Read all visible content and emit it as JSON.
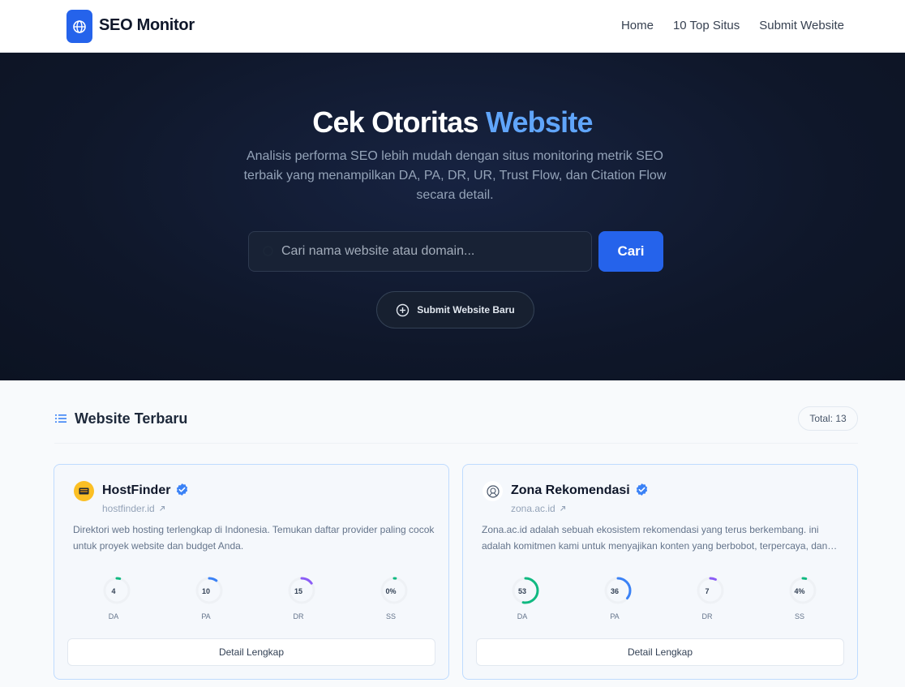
{
  "header": {
    "brand": "SEO Monitor",
    "nav": [
      "Home",
      "10 Top Situs",
      "Submit Website"
    ]
  },
  "hero": {
    "title_main": "Cek Otoritas ",
    "title_accent": "Website",
    "description": "Analisis performa SEO lebih mudah dengan situs monitoring metrik SEO terbaik yang menampilkan DA, PA, DR, UR, Trust Flow, dan Citation Flow secara detail.",
    "search_placeholder": "Cari nama website atau domain...",
    "search_button": "Cari",
    "submit_button": "Submit Website Baru"
  },
  "section": {
    "title": "Website Terbaru",
    "total": "Total: 13"
  },
  "cards": [
    {
      "name": "HostFinder",
      "domain": "hostfinder.id",
      "description": "Direktori web hosting terlengkap di Indonesia. Temukan daftar provider paling cocok untuk proyek website dan budget Anda.",
      "metrics": [
        {
          "label": "DA",
          "value": "4",
          "percent": 4,
          "color": "#10b981"
        },
        {
          "label": "PA",
          "value": "10",
          "percent": 10,
          "color": "#3b82f6"
        },
        {
          "label": "DR",
          "value": "15",
          "percent": 15,
          "color": "#8b5cf6"
        },
        {
          "label": "SS",
          "value": "0%",
          "percent": 0,
          "color": "#10b981"
        }
      ],
      "button": "Detail Lengkap"
    },
    {
      "name": "Zona Rekomendasi",
      "domain": "zona.ac.id",
      "description": "Zona.ac.id adalah sebuah ekosistem rekomendasi yang terus berkembang. ini adalah komitmen kami untuk menyajikan konten yang berbobot, terpercaya, dan relevan.",
      "metrics": [
        {
          "label": "DA",
          "value": "53",
          "percent": 53,
          "color": "#10b981"
        },
        {
          "label": "PA",
          "value": "36",
          "percent": 36,
          "color": "#3b82f6"
        },
        {
          "label": "DR",
          "value": "7",
          "percent": 7,
          "color": "#8b5cf6"
        },
        {
          "label": "SS",
          "value": "4%",
          "percent": 4,
          "color": "#10b981"
        }
      ],
      "button": "Detail Lengkap"
    }
  ],
  "colors": {
    "primary": "#2563eb",
    "accent": "#60a5fa",
    "hero_bg": "#0f172a",
    "verified": "#3b82f6"
  }
}
